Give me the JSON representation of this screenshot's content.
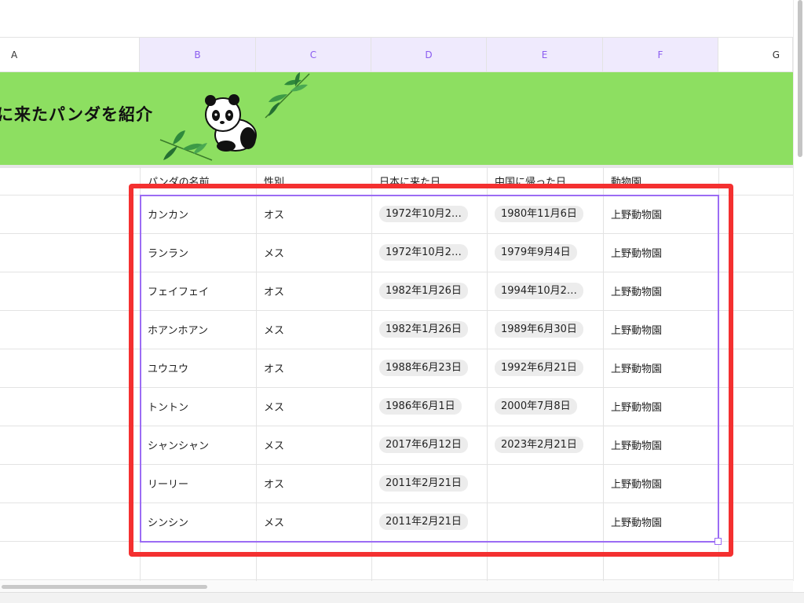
{
  "columns": [
    "A",
    "B",
    "C",
    "D",
    "E",
    "F",
    "G"
  ],
  "banner": {
    "title": "に来たパンダを紹介"
  },
  "table": {
    "headers": [
      "パンダの名前",
      "性別",
      "日本に来た日",
      "中国に帰った日",
      "動物園"
    ],
    "rows": [
      [
        "カンカン",
        "オス",
        "1972年10月2…",
        "1980年11月6日",
        "上野動物園"
      ],
      [
        "ランラン",
        "メス",
        "1972年10月2…",
        "1979年9月4日",
        "上野動物園"
      ],
      [
        "フェイフェイ",
        "オス",
        "1982年1月26日",
        "1994年10月2…",
        "上野動物園"
      ],
      [
        "ホアンホアン",
        "メス",
        "1982年1月26日",
        "1989年6月30日",
        "上野動物園"
      ],
      [
        "ユウユウ",
        "オス",
        "1988年6月23日",
        "1992年6月21日",
        "上野動物園"
      ],
      [
        "トントン",
        "メス",
        "1986年6月1日",
        "2000年7月8日",
        "上野動物園"
      ],
      [
        "シャンシャン",
        "メス",
        "2017年6月12日",
        "2023年2月21日",
        "上野動物園"
      ],
      [
        "リーリー",
        "オス",
        "2011年2月21日",
        "",
        "上野動物園"
      ],
      [
        "シンシン",
        "メス",
        "2011年2月21日",
        "",
        "上野動物園"
      ]
    ]
  },
  "colors": {
    "accent": "#9b6cf4",
    "highlight": "#f43030",
    "banner": "#8ddf61"
  }
}
